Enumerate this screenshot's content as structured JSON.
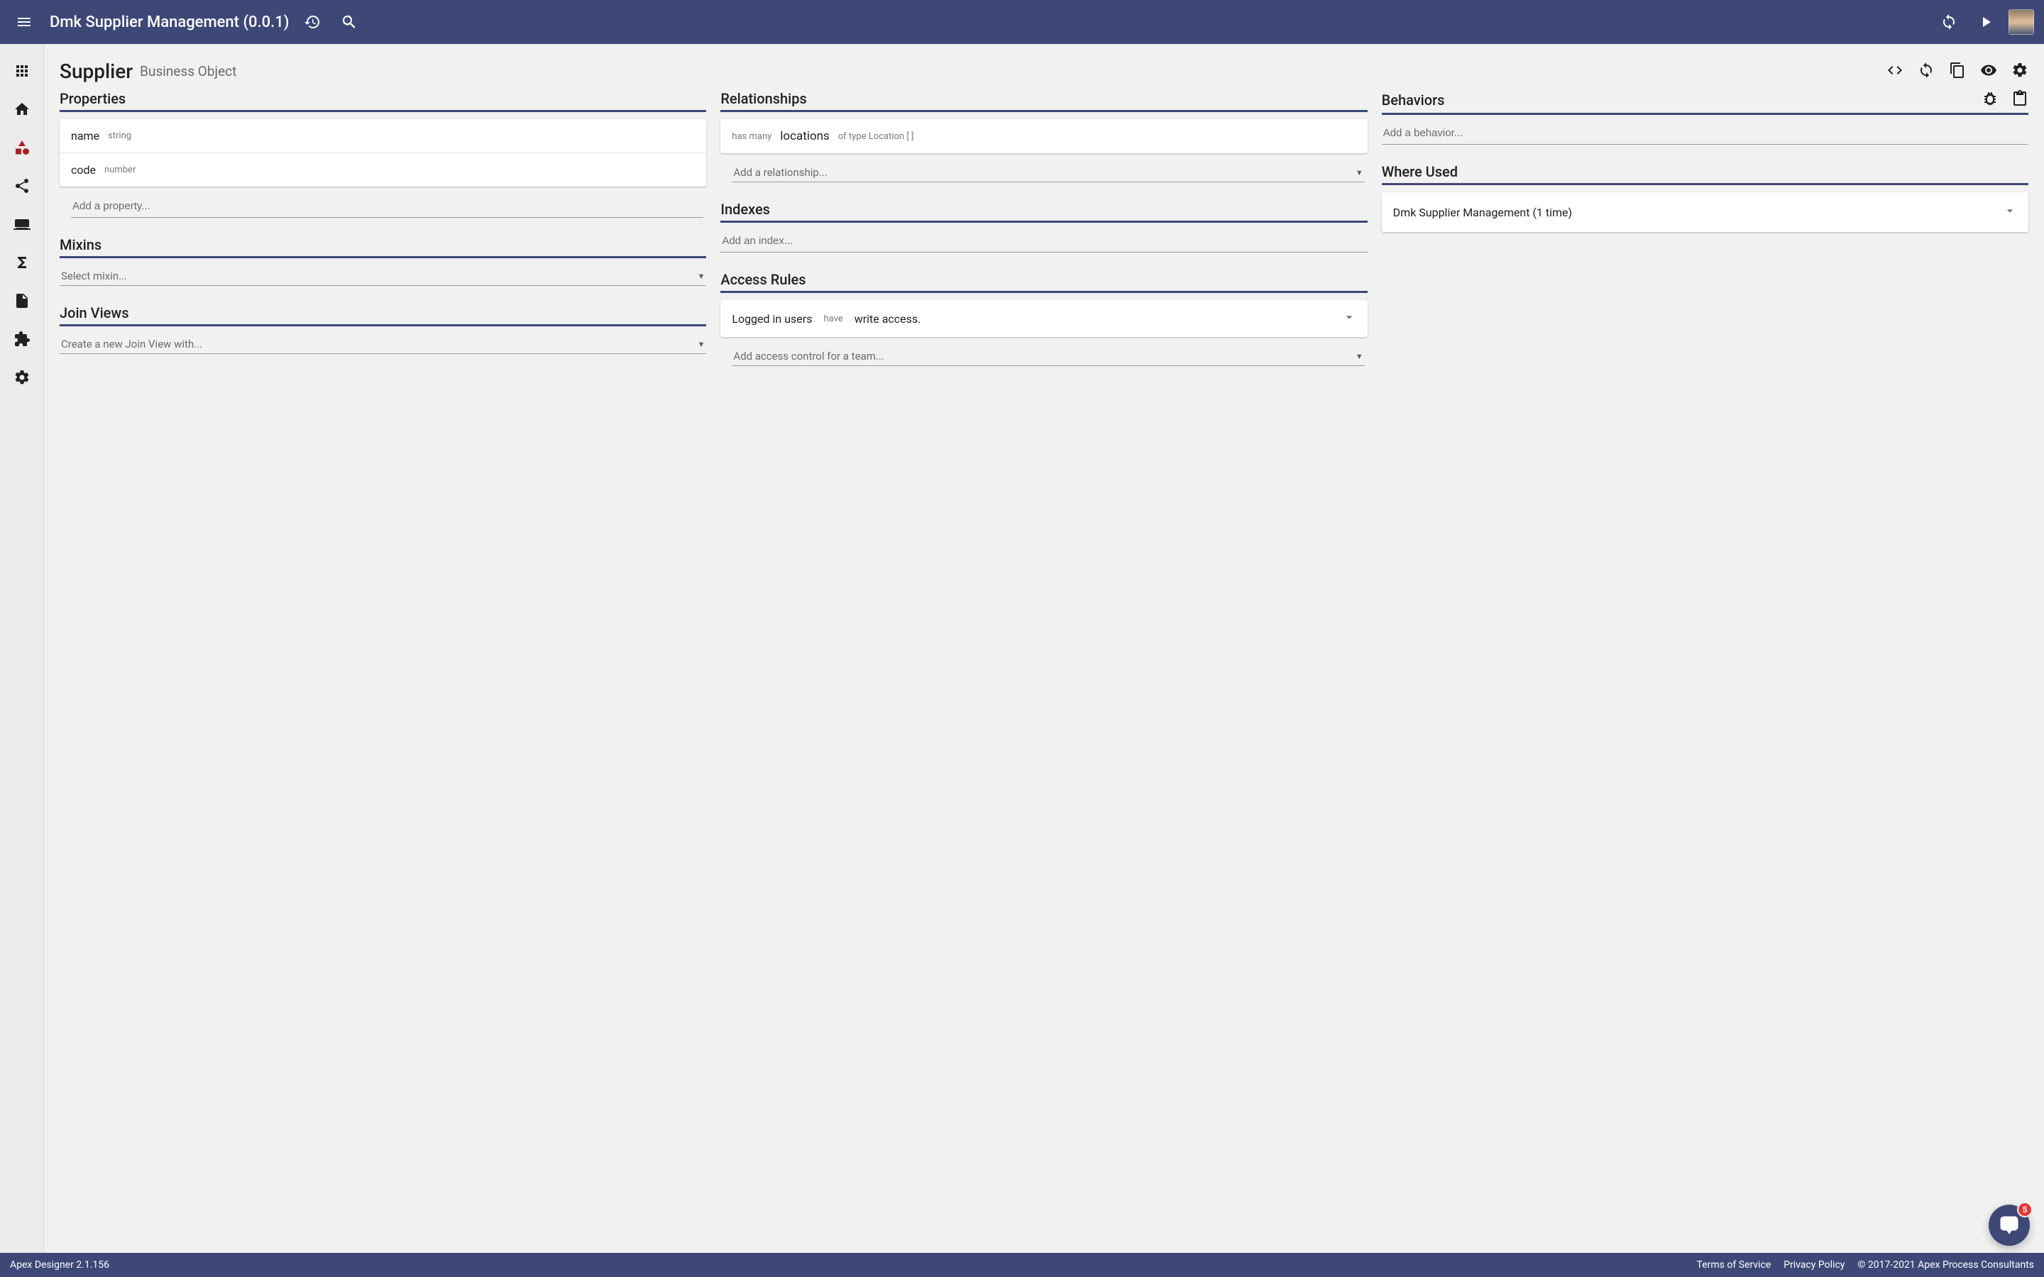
{
  "appbar": {
    "title": "Dmk Supplier Management (0.0.1)"
  },
  "page": {
    "title": "Supplier",
    "subtitle": "Business Object"
  },
  "properties": {
    "heading": "Properties",
    "items": [
      {
        "name": "name",
        "type": "string"
      },
      {
        "name": "code",
        "type": "number"
      }
    ],
    "add_placeholder": "Add a property..."
  },
  "relationships": {
    "heading": "Relationships",
    "items": [
      {
        "prefix": "has many",
        "name": "locations",
        "suffix": "of type Location [ ]"
      }
    ],
    "add_placeholder": "Add a relationship..."
  },
  "behaviors": {
    "heading": "Behaviors",
    "add_placeholder": "Add a behavior..."
  },
  "mixins": {
    "heading": "Mixins",
    "select_placeholder": "Select mixin..."
  },
  "indexes": {
    "heading": "Indexes",
    "add_placeholder": "Add an index..."
  },
  "where_used": {
    "heading": "Where Used",
    "items": [
      {
        "label": "Dmk Supplier Management (1 time)"
      }
    ]
  },
  "join_views": {
    "heading": "Join Views",
    "create_placeholder": "Create a new Join View with..."
  },
  "access_rules": {
    "heading": "Access Rules",
    "items": [
      {
        "subject": "Logged in users",
        "mid": "have",
        "object": "write access."
      }
    ],
    "add_placeholder": "Add access control for a team..."
  },
  "footer": {
    "app": "Apex Designer 2.1.156",
    "terms": "Terms of Service",
    "privacy": "Privacy Policy",
    "copyright": "© 2017-2021 Apex Process Consultants"
  },
  "chat": {
    "badge": "5"
  }
}
